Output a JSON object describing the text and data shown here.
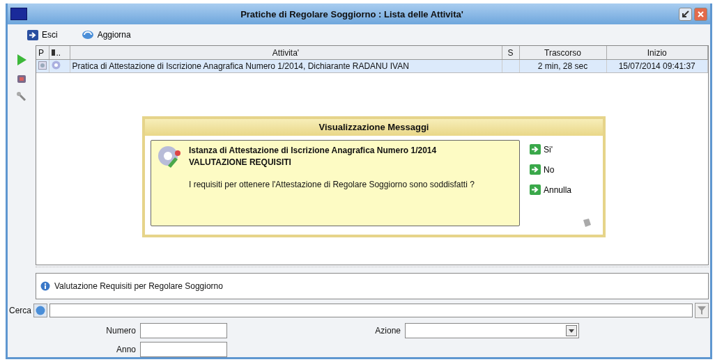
{
  "window": {
    "title": "Pratiche di Regolare Soggiorno : Lista delle Attivita'"
  },
  "toolbar": [
    {
      "label": "Esci",
      "kind": "exit"
    },
    {
      "label": "Aggiorna",
      "kind": "refresh"
    }
  ],
  "side_tools": [
    {
      "kind": "play"
    },
    {
      "kind": "tool"
    },
    {
      "kind": "wrench"
    }
  ],
  "grid": {
    "columns": [
      "P",
      "..",
      "Attivita'",
      "S",
      "Trascorso",
      "Inizio"
    ],
    "rows": [
      {
        "selected": true,
        "cells": [
          "",
          "",
          "Pratica di Attestazione di Iscrizione Anagrafica Numero 1/2014, Dichiarante RADANU IVAN",
          "",
          "2 min, 28 sec",
          "15/07/2014 09:41:37"
        ]
      }
    ]
  },
  "dialog": {
    "title": "Visualizzazione Messaggi",
    "heading": [
      "Istanza di Attestazione di Iscrizione Anagrafica Numero 1/2014",
      "VALUTAZIONE REQUISITI"
    ],
    "question": "I requisiti per ottenere l'Attestazione di Regolare Soggiorno sono soddisfatti ?",
    "buttons": [
      "Si'",
      "No",
      "Annulla"
    ]
  },
  "info": "Valutazione Requisiti per Regolare Soggiorno",
  "search": {
    "label": "Cerca"
  },
  "fields": [
    {
      "label": "Numero",
      "kind": "text"
    },
    {
      "label": "Azione",
      "kind": "select"
    },
    {
      "label": "Anno",
      "kind": "text"
    }
  ]
}
